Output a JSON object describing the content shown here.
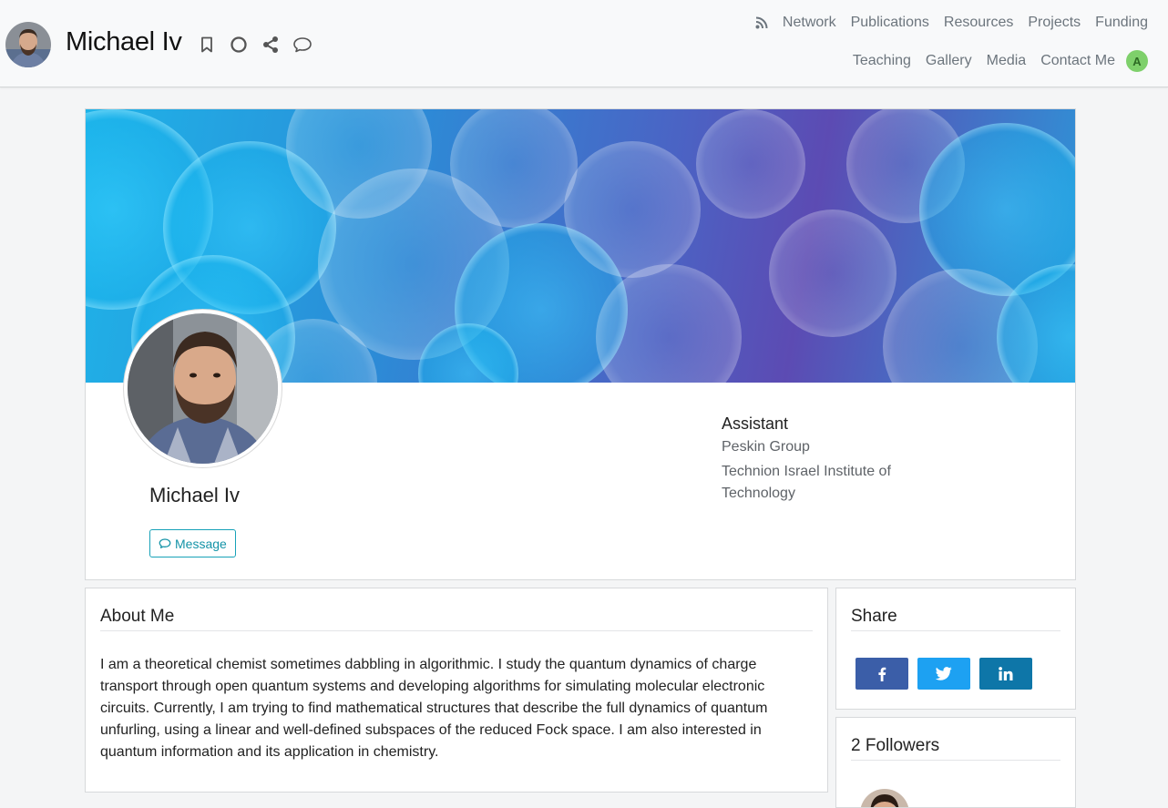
{
  "header": {
    "name": "Michael Iv",
    "icons": [
      "bookmark-icon",
      "circle-icon",
      "share-icon",
      "comment-icon"
    ],
    "nav_row1": [
      "Network",
      "Publications",
      "Resources",
      "Projects",
      "Funding"
    ],
    "nav_row2": [
      "Teaching",
      "Gallery",
      "Media",
      "Contact Me"
    ],
    "user_initial": "A"
  },
  "profile": {
    "name": "Michael Iv",
    "message_label": "Message",
    "role": "Assistant",
    "group": "Peskin Group",
    "institution": "Technion Israel Institute of Technology"
  },
  "about": {
    "title": "About Me",
    "text": "I am a theoretical chemist sometimes dabbling in algorithmic. I study the quantum dynamics of charge transport through open quantum systems and developing algorithms for simulating molecular electronic circuits. Currently, I am trying to find mathematical structures that describe the full dynamics of quantum unfurling, using a linear and well-defined subspaces of the reduced Fock space. I am also interested in quantum information and its application in chemistry."
  },
  "share": {
    "title": "Share",
    "buttons": [
      "facebook-icon",
      "twitter-icon",
      "linkedin-icon"
    ]
  },
  "followers": {
    "title": "2 Followers"
  },
  "colors": {
    "accent": "#17a2b8",
    "facebook": "#3b5ea8",
    "twitter": "#1da1f2",
    "linkedin": "#0e76a8",
    "user_badge": "#7ed06b"
  }
}
